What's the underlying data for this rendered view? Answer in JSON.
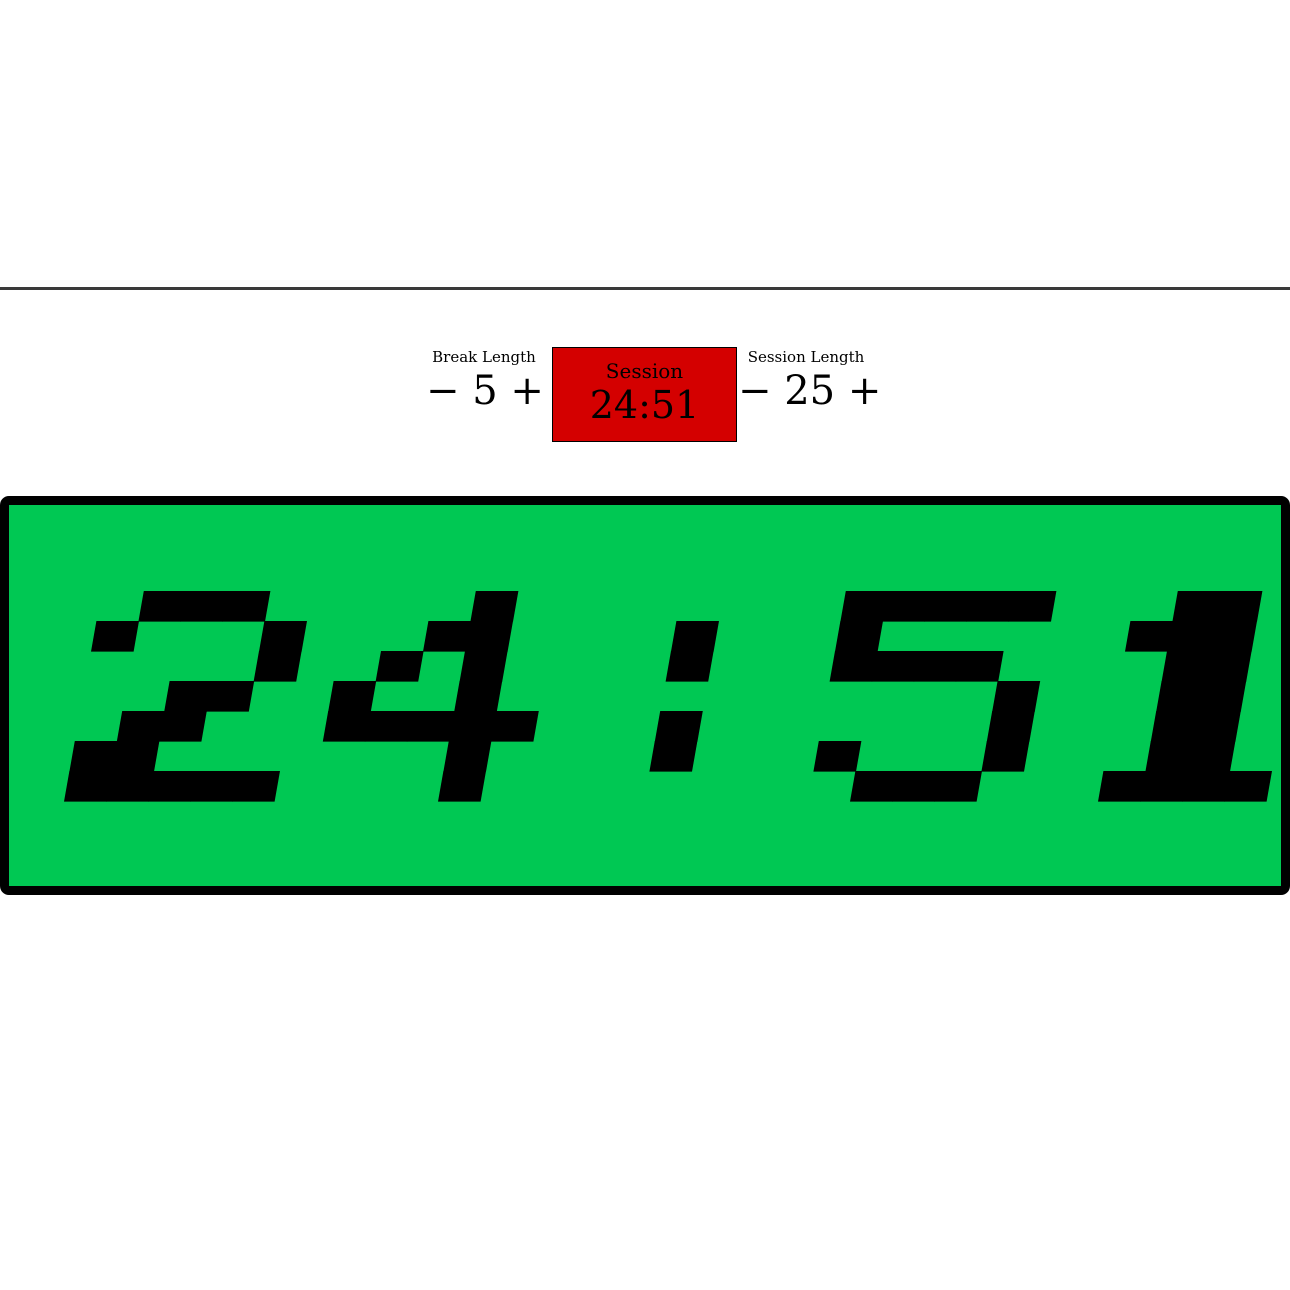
{
  "break": {
    "label": "Break Length",
    "value": "5",
    "decrement_label": "−",
    "increment_label": "+"
  },
  "session": {
    "label": "Session Length",
    "value": "25",
    "decrement_label": "−",
    "increment_label": "+"
  },
  "status": {
    "mode": "Session",
    "time": "24:51",
    "color": "#d40000"
  },
  "display": {
    "time": "24:51",
    "background": "#00c853",
    "digit_color": "#000000"
  }
}
